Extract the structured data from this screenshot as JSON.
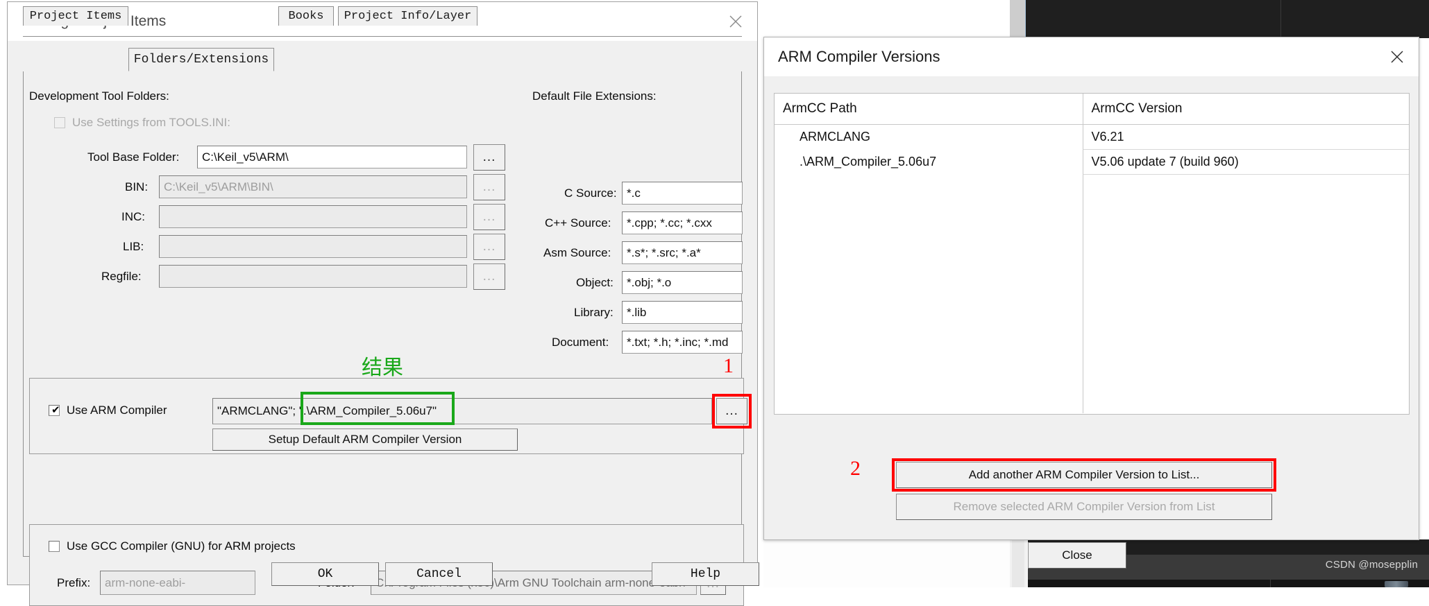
{
  "background": {
    "watermark": "CSDN @mosepplin"
  },
  "manage_dialog": {
    "title": "Manage Project Items",
    "close_icon": "close-icon",
    "tabs": [
      {
        "label": "Project Items",
        "active": false
      },
      {
        "label": "Folders/Extensions",
        "active": true
      },
      {
        "label": "Books",
        "active": false
      },
      {
        "label": "Project Info/Layer",
        "active": false
      }
    ],
    "dev_tool_folders": {
      "group_label": "Development Tool Folders:",
      "use_tools_ini": {
        "label": "Use Settings from TOOLS.INI:",
        "checked": false,
        "enabled": false
      },
      "fields": [
        {
          "label": "Tool Base Folder:",
          "value": "C:\\Keil_v5\\ARM\\",
          "enabled": true,
          "browse": "..."
        },
        {
          "label": "BIN:",
          "value": "C:\\Keil_v5\\ARM\\BIN\\",
          "enabled": false,
          "browse": "..."
        },
        {
          "label": "INC:",
          "value": "",
          "enabled": false,
          "browse": "..."
        },
        {
          "label": "LIB:",
          "value": "",
          "enabled": false,
          "browse": "..."
        },
        {
          "label": "Regfile:",
          "value": "",
          "enabled": false,
          "browse": "..."
        }
      ]
    },
    "default_extensions": {
      "group_label": "Default File Extensions:",
      "rows": [
        {
          "label": "C Source:",
          "value": "*.c"
        },
        {
          "label": "C++ Source:",
          "value": "*.cpp; *.cc; *.cxx"
        },
        {
          "label": "Asm Source:",
          "value": "*.s*; *.src; *.a*"
        },
        {
          "label": "Object:",
          "value": "*.obj; *.o"
        },
        {
          "label": "Library:",
          "value": "*.lib"
        },
        {
          "label": "Document:",
          "value": "*.txt; *.h; *.inc; *.md"
        }
      ]
    },
    "arm_compiler": {
      "checkbox_label": "Use ARM Compiler",
      "checked": true,
      "value": "\"ARMCLANG\"; \".\\ARM_Compiler_5.06u7\"",
      "value_prefix": "\"ARMCLANG\"; \"",
      "value_highlight": ".\\ARM_Compiler_5.06u7\"",
      "browse": "...",
      "setup_button": "Setup Default ARM Compiler Version"
    },
    "gcc_compiler": {
      "checkbox_label": "Use GCC Compiler (GNU) for ARM projects",
      "checked": false,
      "prefix_label": "Prefix:",
      "prefix_value": "arm-none-eabi-",
      "folder_label": "Folder:",
      "folder_value": "C:\\Program Files (x86)\\Arm GNU Toolchain arm-none-eabi\\",
      "browse": "..."
    },
    "buttons": {
      "ok": "OK",
      "cancel": "Cancel",
      "help": "Help"
    }
  },
  "versions_dialog": {
    "title": "ARM Compiler Versions",
    "close_icon": "close-icon",
    "table": {
      "columns": [
        "ArmCC Path",
        "ArmCC Version"
      ],
      "rows": [
        [
          "ARMCLANG",
          "V6.21"
        ],
        [
          ".\\ARM_Compiler_5.06u7",
          "V5.06 update 7 (build 960)"
        ]
      ]
    },
    "buttons": {
      "add": "Add another ARM Compiler Version to List...",
      "remove": "Remove selected ARM Compiler Version from List",
      "remove_enabled": false,
      "close": "Close"
    }
  },
  "annotations": {
    "green_label": "结果",
    "step_one": "1",
    "step_two": "2",
    "red": "#ff0000",
    "green": "#1aa81a"
  }
}
